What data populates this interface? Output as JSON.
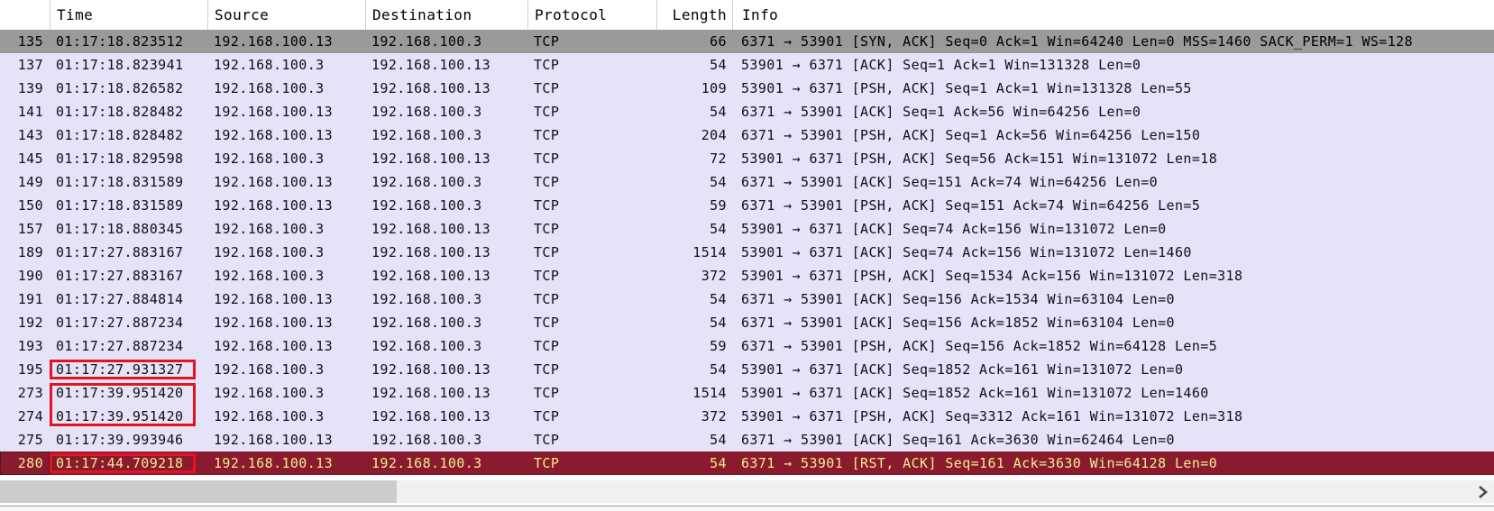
{
  "table": {
    "columns": [
      {
        "label": ""
      },
      {
        "label": "Time"
      },
      {
        "label": "Source"
      },
      {
        "label": "Destination"
      },
      {
        "label": "Protocol"
      },
      {
        "label": "Length"
      },
      {
        "label": "Info"
      }
    ],
    "rows": [
      {
        "no": "135",
        "time": "01:17:18.823512",
        "source": "192.168.100.13",
        "destination": "192.168.100.3",
        "protocol": "TCP",
        "length": "66",
        "info": "6371 → 53901 [SYN, ACK] Seq=0 Ack=1 Win=64240 Len=0 MSS=1460 SACK_PERM=1 WS=128",
        "selected": true
      },
      {
        "no": "137",
        "time": "01:17:18.823941",
        "source": "192.168.100.3",
        "destination": "192.168.100.13",
        "protocol": "TCP",
        "length": "54",
        "info": "53901 → 6371 [ACK] Seq=1 Ack=1 Win=131328 Len=0"
      },
      {
        "no": "139",
        "time": "01:17:18.826582",
        "source": "192.168.100.3",
        "destination": "192.168.100.13",
        "protocol": "TCP",
        "length": "109",
        "info": "53901 → 6371 [PSH, ACK] Seq=1 Ack=1 Win=131328 Len=55"
      },
      {
        "no": "141",
        "time": "01:17:18.828482",
        "source": "192.168.100.13",
        "destination": "192.168.100.3",
        "protocol": "TCP",
        "length": "54",
        "info": "6371 → 53901 [ACK] Seq=1 Ack=56 Win=64256 Len=0"
      },
      {
        "no": "143",
        "time": "01:17:18.828482",
        "source": "192.168.100.13",
        "destination": "192.168.100.3",
        "protocol": "TCP",
        "length": "204",
        "info": "6371 → 53901 [PSH, ACK] Seq=1 Ack=56 Win=64256 Len=150"
      },
      {
        "no": "145",
        "time": "01:17:18.829598",
        "source": "192.168.100.3",
        "destination": "192.168.100.13",
        "protocol": "TCP",
        "length": "72",
        "info": "53901 → 6371 [PSH, ACK] Seq=56 Ack=151 Win=131072 Len=18"
      },
      {
        "no": "149",
        "time": "01:17:18.831589",
        "source": "192.168.100.13",
        "destination": "192.168.100.3",
        "protocol": "TCP",
        "length": "54",
        "info": "6371 → 53901 [ACK] Seq=151 Ack=74 Win=64256 Len=0"
      },
      {
        "no": "150",
        "time": "01:17:18.831589",
        "source": "192.168.100.13",
        "destination": "192.168.100.3",
        "protocol": "TCP",
        "length": "59",
        "info": "6371 → 53901 [PSH, ACK] Seq=151 Ack=74 Win=64256 Len=5"
      },
      {
        "no": "157",
        "time": "01:17:18.880345",
        "source": "192.168.100.3",
        "destination": "192.168.100.13",
        "protocol": "TCP",
        "length": "54",
        "info": "53901 → 6371 [ACK] Seq=74 Ack=156 Win=131072 Len=0"
      },
      {
        "no": "189",
        "time": "01:17:27.883167",
        "source": "192.168.100.3",
        "destination": "192.168.100.13",
        "protocol": "TCP",
        "length": "1514",
        "info": "53901 → 6371 [ACK] Seq=74 Ack=156 Win=131072 Len=1460"
      },
      {
        "no": "190",
        "time": "01:17:27.883167",
        "source": "192.168.100.3",
        "destination": "192.168.100.13",
        "protocol": "TCP",
        "length": "372",
        "info": "53901 → 6371 [PSH, ACK] Seq=1534 Ack=156 Win=131072 Len=318"
      },
      {
        "no": "191",
        "time": "01:17:27.884814",
        "source": "192.168.100.13",
        "destination": "192.168.100.3",
        "protocol": "TCP",
        "length": "54",
        "info": "6371 → 53901 [ACK] Seq=156 Ack=1534 Win=63104 Len=0"
      },
      {
        "no": "192",
        "time": "01:17:27.887234",
        "source": "192.168.100.13",
        "destination": "192.168.100.3",
        "protocol": "TCP",
        "length": "54",
        "info": "6371 → 53901 [ACK] Seq=156 Ack=1852 Win=63104 Len=0"
      },
      {
        "no": "193",
        "time": "01:17:27.887234",
        "source": "192.168.100.13",
        "destination": "192.168.100.3",
        "protocol": "TCP",
        "length": "59",
        "info": "6371 → 53901 [PSH, ACK] Seq=156 Ack=1852 Win=64128 Len=5"
      },
      {
        "no": "195",
        "time": "01:17:27.931327",
        "source": "192.168.100.3",
        "destination": "192.168.100.13",
        "protocol": "TCP",
        "length": "54",
        "info": "53901 → 6371 [ACK] Seq=1852 Ack=161 Win=131072 Len=0",
        "time_box": "solo"
      },
      {
        "no": "273",
        "time": "01:17:39.951420",
        "source": "192.168.100.3",
        "destination": "192.168.100.13",
        "protocol": "TCP",
        "length": "1514",
        "info": "53901 → 6371 [ACK] Seq=1852 Ack=161 Win=131072 Len=1460",
        "time_box": "start"
      },
      {
        "no": "274",
        "time": "01:17:39.951420",
        "source": "192.168.100.3",
        "destination": "192.168.100.13",
        "protocol": "TCP",
        "length": "372",
        "info": "53901 → 6371 [PSH, ACK] Seq=3312 Ack=161 Win=131072 Len=318",
        "time_box": "end"
      },
      {
        "no": "275",
        "time": "01:17:39.993946",
        "source": "192.168.100.13",
        "destination": "192.168.100.3",
        "protocol": "TCP",
        "length": "54",
        "info": "6371 → 53901 [ACK] Seq=161 Ack=3630 Win=62464 Len=0"
      },
      {
        "no": "280",
        "time": "01:17:44.709218",
        "source": "192.168.100.13",
        "destination": "192.168.100.3",
        "protocol": "TCP",
        "length": "54",
        "info": "6371 → 53901 [RST, ACK] Seq=161 Ack=3630 Win=64128 Len=0",
        "rst": true,
        "time_box": "solo"
      }
    ]
  },
  "colors": {
    "row_default_bg": "#e4e3f7",
    "row_selected_bg": "#9a9a9a",
    "row_rst_bg": "#8a1b2f",
    "row_rst_fg": "#f2ed8d",
    "annotation_red": "#e6121f",
    "scroll_track": "#f0f0f0",
    "scroll_thumb": "#cccccc"
  }
}
